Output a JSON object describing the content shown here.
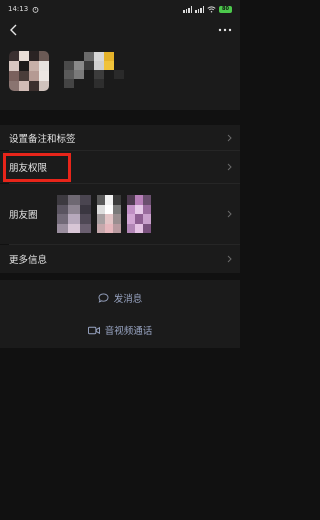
{
  "status_bar": {
    "time": "14:13",
    "battery": "80",
    "icons": [
      "alarm-icon",
      "signal-icon",
      "signal-icon",
      "wifi-icon",
      "battery-icon"
    ]
  },
  "header": {
    "back_icon": "chevron-left-icon",
    "more_icon": "more-dots-icon",
    "avatar_blurred": true,
    "nickname_blurred": true
  },
  "rows": {
    "remark_and_tags": "设置备注和标签",
    "friend_permissions": "朋友权限",
    "moments": "朋友圈",
    "more_info": "更多信息"
  },
  "actions": {
    "send_message": "发消息",
    "video_call": "音视频通话"
  },
  "colors": {
    "background": "#111111",
    "panel": "#1b1b1b",
    "text": "#e6e6e6",
    "action_text": "#9aa6c4",
    "highlight": "#e8251a",
    "battery": "#4cc94c"
  }
}
